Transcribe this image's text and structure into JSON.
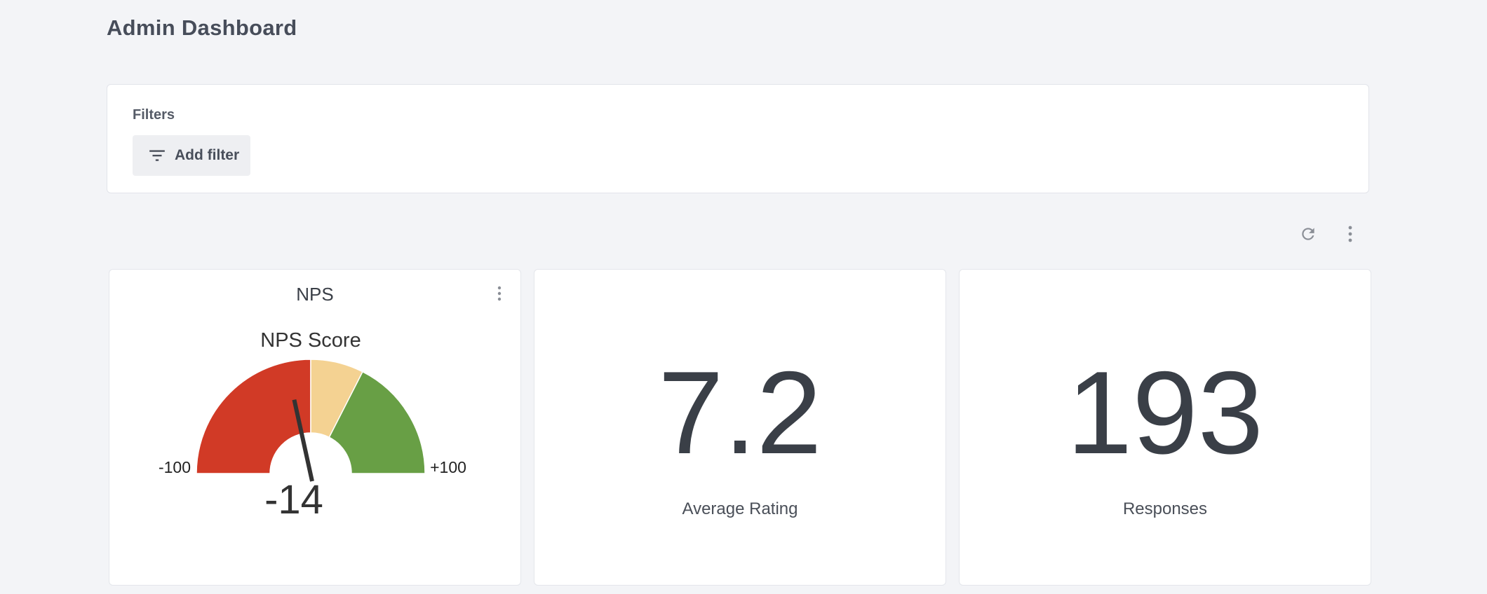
{
  "page": {
    "title": "Admin Dashboard"
  },
  "filters": {
    "label": "Filters",
    "add_filter_label": "Add filter",
    "add_filter_icon": "filter-list-icon"
  },
  "toolbar": {
    "refresh_icon": "refresh-icon",
    "more_icon": "more-vertical-icon"
  },
  "colors": {
    "background": "#f3f4f7",
    "gauge_detractor": "#d13a26",
    "gauge_passive": "#f4d292",
    "gauge_promoter": "#689f45",
    "needle": "#333333"
  },
  "cards": {
    "nps": {
      "title": "NPS",
      "menu_icon": "more-vertical-icon"
    },
    "average_rating": {
      "value": "7.2",
      "label": "Average Rating"
    },
    "responses": {
      "value": "193",
      "label": "Responses"
    }
  },
  "chart_data": {
    "type": "gauge",
    "title": "NPS Score",
    "min": -100,
    "max": 100,
    "min_label": "-100",
    "max_label": "+100",
    "value": -14,
    "value_label": "-14",
    "bands": [
      {
        "from": -100,
        "to": 0,
        "color": "#d13a26"
      },
      {
        "from": 0,
        "to": 30,
        "color": "#f4d292"
      },
      {
        "from": 30,
        "to": 100,
        "color": "#689f45"
      }
    ]
  }
}
